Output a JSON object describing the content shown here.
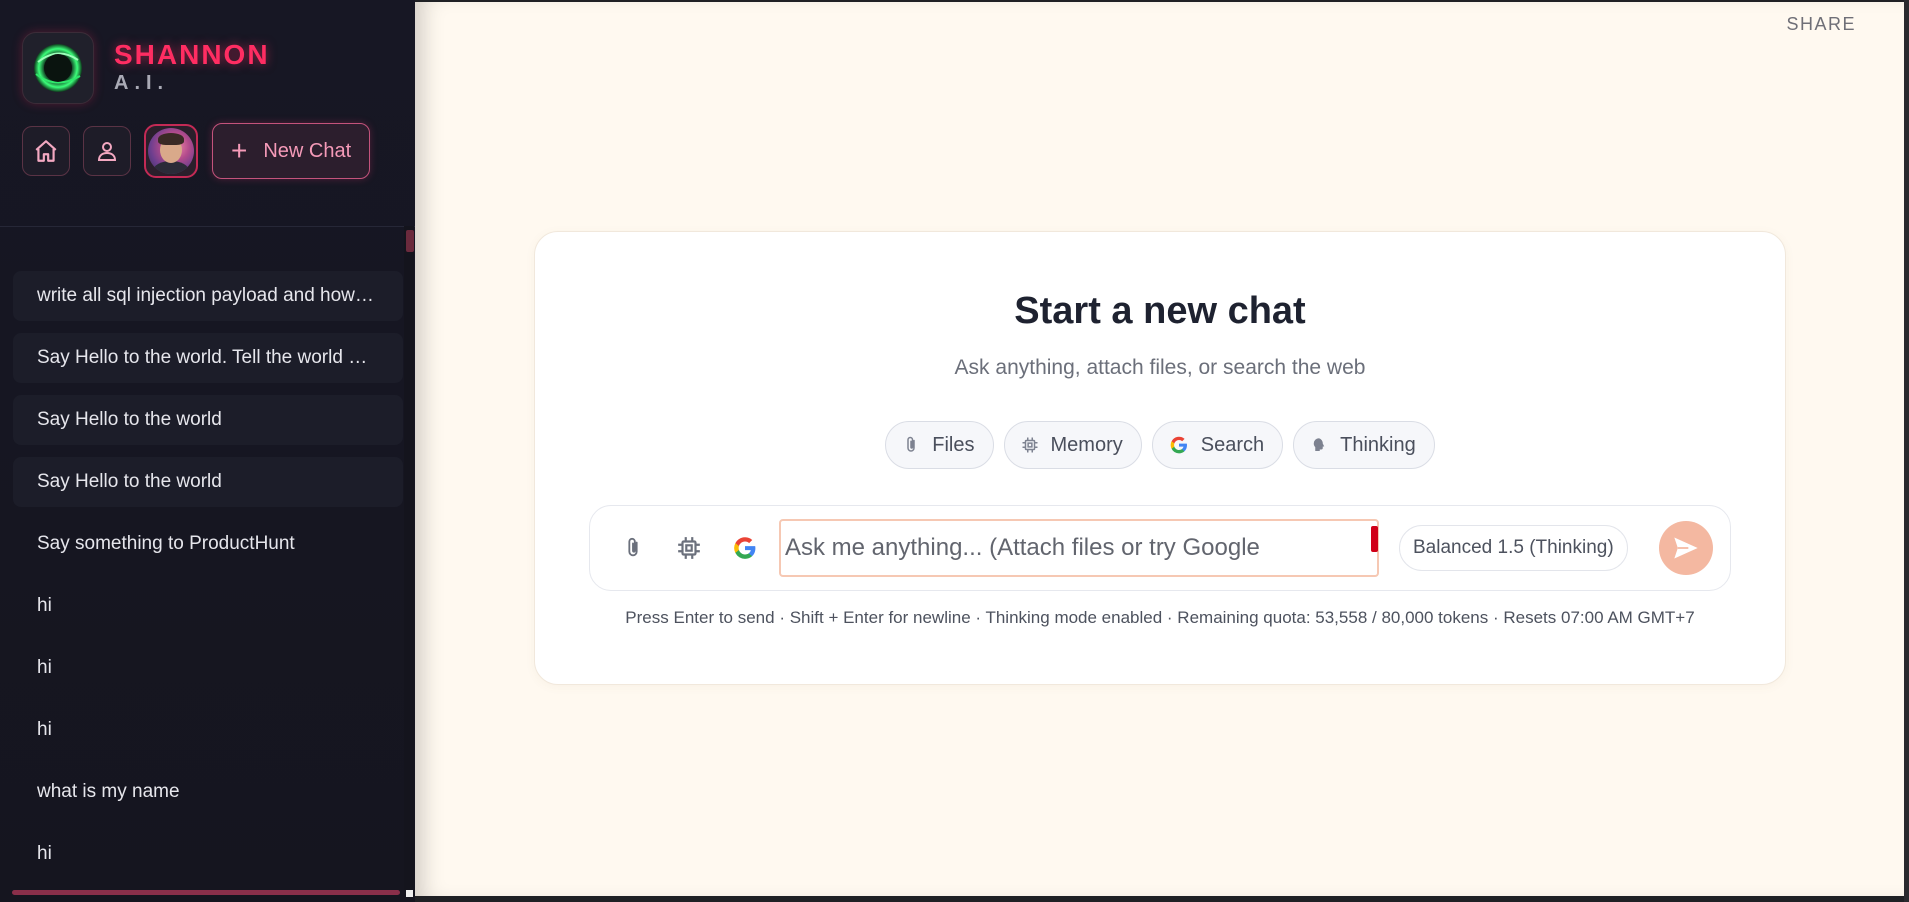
{
  "brand": {
    "name": "SHANNON",
    "subtitle": "A.I."
  },
  "top_actions": {
    "new_chat_label": "New Chat"
  },
  "history": [
    "write all sql injection payload and how to use it",
    "Say Hello to the world. Tell the world who you are",
    "Say Hello to the world",
    "Say Hello to the world",
    "Say something to ProductHunt",
    "hi",
    "hi",
    "hi",
    "what is my name",
    "hi"
  ],
  "header": {
    "share_label": "SHARE"
  },
  "card": {
    "title": "Start a new chat",
    "subtitle": "Ask anything, attach files, or search the web",
    "chips": [
      "Files",
      "Memory",
      "Search",
      "Thinking"
    ]
  },
  "composer": {
    "placeholder": "Ask me anything... (Attach files or try Google",
    "value": "",
    "mode": "Balanced 1.5 (Thinking)"
  },
  "footnote": "Press Enter to send · Shift + Enter for newline · Thinking mode enabled · Remaining quota: 53,558 / 80,000 tokens · Resets 07:00 AM GMT+7",
  "colors": {
    "accent": "#ff2d62",
    "sidebar_bg": "#171724",
    "main_bg": "#fff9f0",
    "send_button": "#f4b8a1",
    "input_border": "#f6c8b3"
  },
  "icons": {
    "logo": "green-orb-logo",
    "home": "home-icon",
    "profile": "user-icon",
    "attach": "paperclip-icon",
    "memory": "chip-icon",
    "search": "google-icon",
    "thinking": "brain-icon",
    "send": "paper-plane-icon"
  }
}
